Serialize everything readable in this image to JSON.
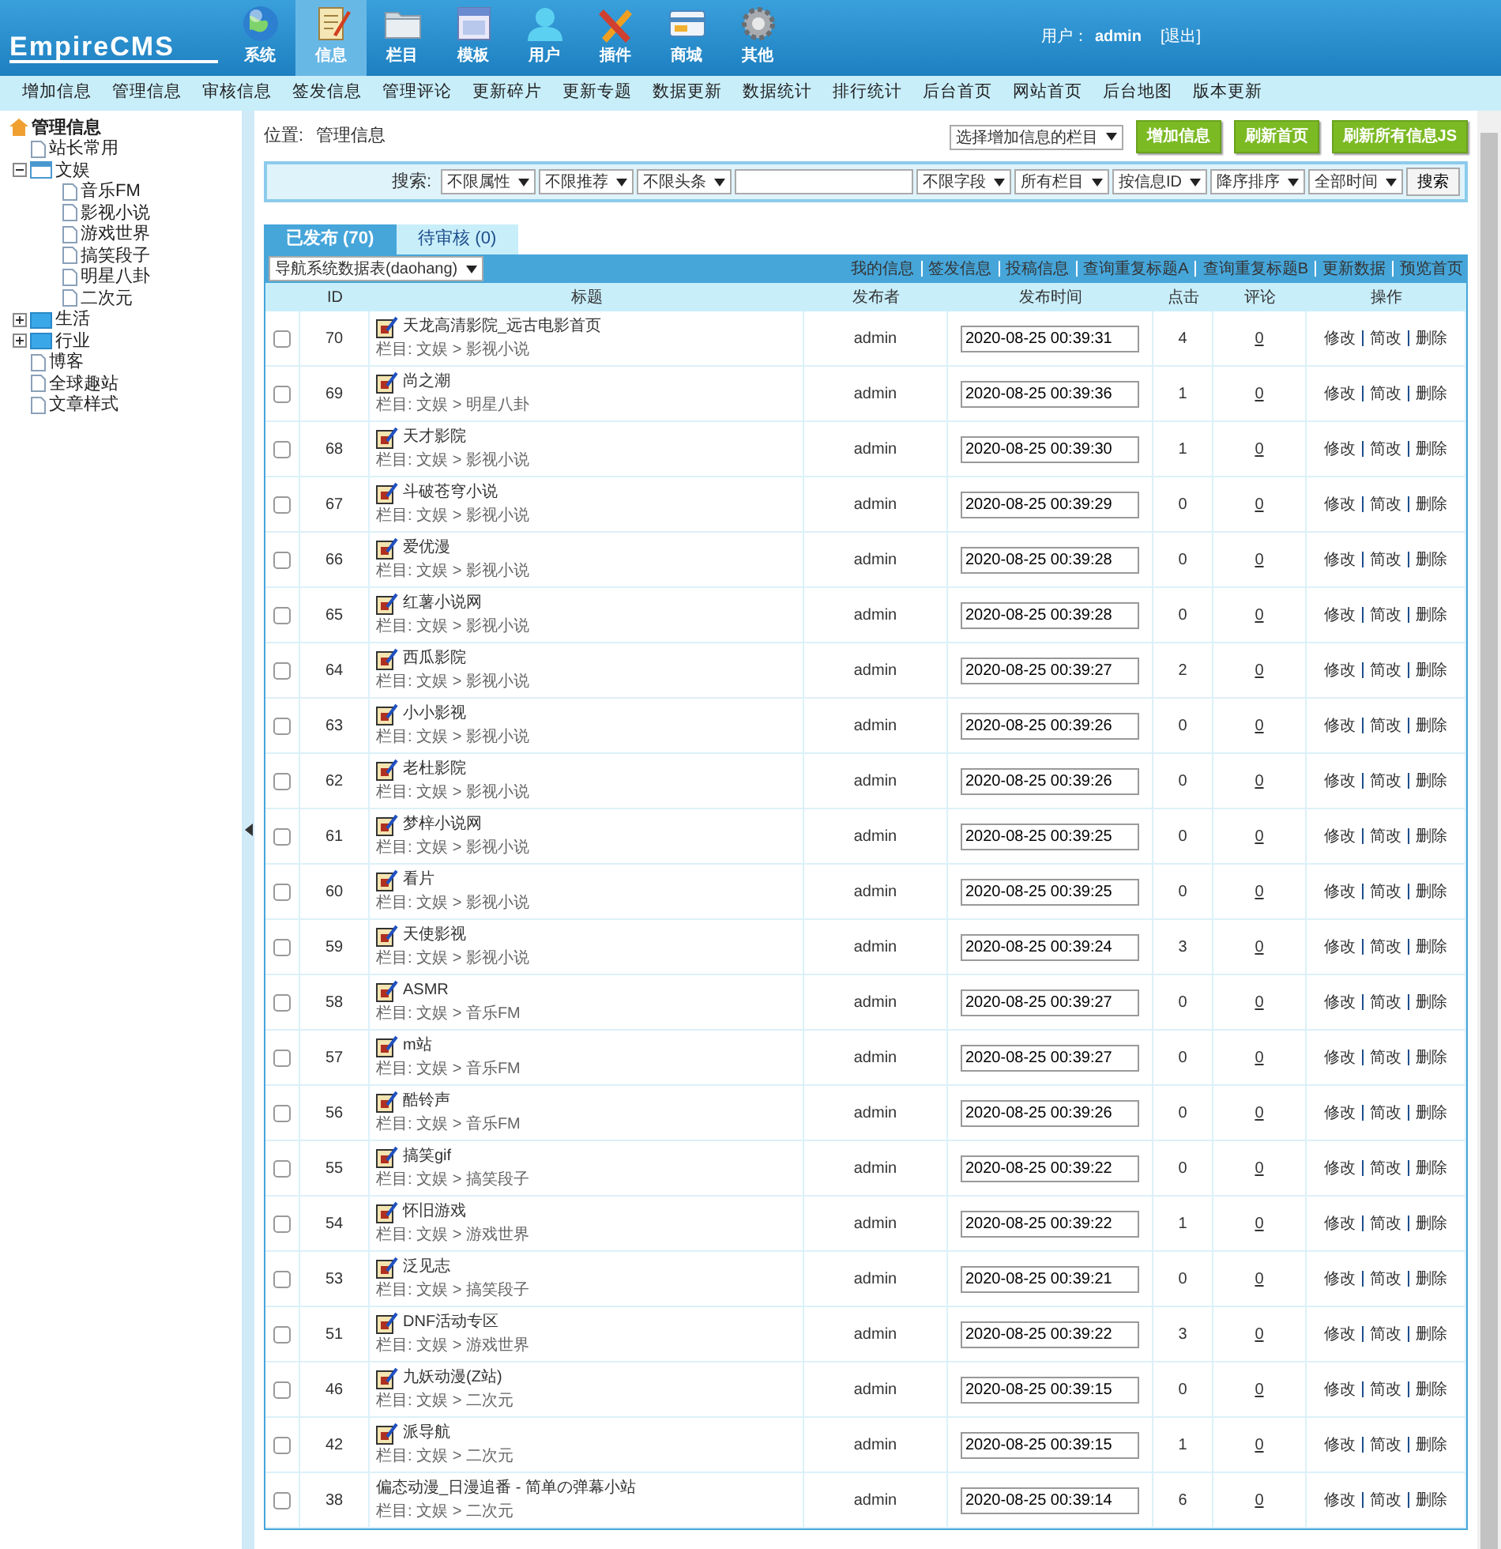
{
  "header": {
    "logo": "EmpireCMS",
    "nav": [
      {
        "label": "系统",
        "selected": false
      },
      {
        "label": "信息",
        "selected": true
      },
      {
        "label": "栏目",
        "selected": false
      },
      {
        "label": "模板",
        "selected": false
      },
      {
        "label": "用户",
        "selected": false
      },
      {
        "label": "插件",
        "selected": false
      },
      {
        "label": "商城",
        "selected": false
      },
      {
        "label": "其他",
        "selected": false
      }
    ],
    "user_label": "用户：",
    "user_name": "admin",
    "logout": "[退出]"
  },
  "submenu": [
    "增加信息",
    "管理信息",
    "审核信息",
    "签发信息",
    "管理评论",
    "更新碎片",
    "更新专题",
    "数据更新",
    "数据统计",
    "排行统计",
    "后台首页",
    "网站首页",
    "后台地图",
    "版本更新"
  ],
  "sidebar": {
    "root": "管理信息",
    "items": [
      {
        "label": "站长常用",
        "kind": "page"
      },
      {
        "label": "文娱",
        "kind": "folder",
        "expanded": true,
        "children": [
          {
            "label": "音乐FM",
            "kind": "page"
          },
          {
            "label": "影视小说",
            "kind": "page"
          },
          {
            "label": "游戏世界",
            "kind": "page"
          },
          {
            "label": "搞笑段子",
            "kind": "page"
          },
          {
            "label": "明星八卦",
            "kind": "page"
          },
          {
            "label": "二次元",
            "kind": "page"
          }
        ]
      },
      {
        "label": "生活",
        "kind": "folder",
        "expanded": false
      },
      {
        "label": "行业",
        "kind": "folder",
        "expanded": false
      },
      {
        "label": "博客",
        "kind": "page"
      },
      {
        "label": "全球趣站",
        "kind": "page"
      },
      {
        "label": "文章样式",
        "kind": "page"
      }
    ]
  },
  "location": {
    "label": "位置:",
    "link": "管理信息"
  },
  "toolbar": {
    "category_select": "选择增加信息的栏目",
    "buttons": [
      "增加信息",
      "刷新首页",
      "刷新所有信息JS"
    ]
  },
  "search": {
    "label": "搜索:",
    "selects_before": [
      "不限属性",
      "不限推荐",
      "不限头条"
    ],
    "selects_after": [
      "不限字段",
      "所有栏目",
      "按信息ID",
      "降序排序",
      "全部时间"
    ],
    "button": "搜索"
  },
  "tabs": [
    {
      "label": "已发布 (70)",
      "selected": true
    },
    {
      "label": "待审核 (0)",
      "selected": false
    }
  ],
  "table": {
    "table_select": "导航系统数据表(daohang)",
    "links": [
      "我的信息",
      "签发信息",
      "投稿信息",
      "查询重复标题A",
      "查询重复标题B",
      "更新数据",
      "预览首页"
    ],
    "columns": [
      "ID",
      "标题",
      "发布者",
      "发布时间",
      "点击",
      "评论",
      "操作"
    ],
    "rows": [
      {
        "id": "70",
        "title": "天龙高清影院_远古电影首页",
        "path": "栏目: 文娱 > 影视小说",
        "icon": true,
        "publisher": "admin",
        "time": "2020-08-25 00:39:31",
        "clicks": "4",
        "comments": "0",
        "actions": [
          "修改",
          "简改",
          "删除"
        ],
        "checked": false
      },
      {
        "id": "69",
        "title": "尚之潮",
        "path": "栏目: 文娱 > 明星八卦",
        "icon": true,
        "publisher": "admin",
        "time": "2020-08-25 00:39:36",
        "clicks": "1",
        "comments": "0",
        "actions": [
          "修改",
          "简改",
          "删除"
        ],
        "checked": false
      },
      {
        "id": "68",
        "title": "天才影院",
        "path": "栏目: 文娱 > 影视小说",
        "icon": true,
        "publisher": "admin",
        "time": "2020-08-25 00:39:30",
        "clicks": "1",
        "comments": "0",
        "actions": [
          "修改",
          "简改",
          "删除"
        ],
        "checked": false
      },
      {
        "id": "67",
        "title": "斗破苍穹小说",
        "path": "栏目: 文娱 > 影视小说",
        "icon": true,
        "publisher": "admin",
        "time": "2020-08-25 00:39:29",
        "clicks": "0",
        "comments": "0",
        "actions": [
          "修改",
          "简改",
          "删除"
        ],
        "checked": false
      },
      {
        "id": "66",
        "title": "爱优漫",
        "path": "栏目: 文娱 > 影视小说",
        "icon": true,
        "publisher": "admin",
        "time": "2020-08-25 00:39:28",
        "clicks": "0",
        "comments": "0",
        "actions": [
          "修改",
          "简改",
          "删除"
        ],
        "checked": false
      },
      {
        "id": "65",
        "title": "红薯小说网",
        "path": "栏目: 文娱 > 影视小说",
        "icon": true,
        "publisher": "admin",
        "time": "2020-08-25 00:39:28",
        "clicks": "0",
        "comments": "0",
        "actions": [
          "修改",
          "简改",
          "删除"
        ],
        "checked": false
      },
      {
        "id": "64",
        "title": "西瓜影院",
        "path": "栏目: 文娱 > 影视小说",
        "icon": true,
        "publisher": "admin",
        "time": "2020-08-25 00:39:27",
        "clicks": "2",
        "comments": "0",
        "actions": [
          "修改",
          "简改",
          "删除"
        ],
        "checked": false
      },
      {
        "id": "63",
        "title": "小小影视",
        "path": "栏目: 文娱 > 影视小说",
        "icon": true,
        "publisher": "admin",
        "time": "2020-08-25 00:39:26",
        "clicks": "0",
        "comments": "0",
        "actions": [
          "修改",
          "简改",
          "删除"
        ],
        "checked": false
      },
      {
        "id": "62",
        "title": "老杜影院",
        "path": "栏目: 文娱 > 影视小说",
        "icon": true,
        "publisher": "admin",
        "time": "2020-08-25 00:39:26",
        "clicks": "0",
        "comments": "0",
        "actions": [
          "修改",
          "简改",
          "删除"
        ],
        "checked": false
      },
      {
        "id": "61",
        "title": "梦梓小说网",
        "path": "栏目: 文娱 > 影视小说",
        "icon": true,
        "publisher": "admin",
        "time": "2020-08-25 00:39:25",
        "clicks": "0",
        "comments": "0",
        "actions": [
          "修改",
          "简改",
          "删除"
        ],
        "checked": false
      },
      {
        "id": "60",
        "title": "看片",
        "path": "栏目: 文娱 > 影视小说",
        "icon": true,
        "publisher": "admin",
        "time": "2020-08-25 00:39:25",
        "clicks": "0",
        "comments": "0",
        "actions": [
          "修改",
          "简改",
          "删除"
        ],
        "checked": false
      },
      {
        "id": "59",
        "title": "天使影视",
        "path": "栏目: 文娱 > 影视小说",
        "icon": true,
        "publisher": "admin",
        "time": "2020-08-25 00:39:24",
        "clicks": "3",
        "comments": "0",
        "actions": [
          "修改",
          "简改",
          "删除"
        ],
        "checked": false
      },
      {
        "id": "58",
        "title": "ASMR",
        "path": "栏目: 文娱 > 音乐FM",
        "icon": true,
        "publisher": "admin",
        "time": "2020-08-25 00:39:27",
        "clicks": "0",
        "comments": "0",
        "actions": [
          "修改",
          "简改",
          "删除"
        ],
        "checked": false
      },
      {
        "id": "57",
        "title": "m站",
        "path": "栏目: 文娱 > 音乐FM",
        "icon": true,
        "publisher": "admin",
        "time": "2020-08-25 00:39:27",
        "clicks": "0",
        "comments": "0",
        "actions": [
          "修改",
          "简改",
          "删除"
        ],
        "checked": false
      },
      {
        "id": "56",
        "title": "酷铃声",
        "path": "栏目: 文娱 > 音乐FM",
        "icon": true,
        "publisher": "admin",
        "time": "2020-08-25 00:39:26",
        "clicks": "0",
        "comments": "0",
        "actions": [
          "修改",
          "简改",
          "删除"
        ],
        "checked": false
      },
      {
        "id": "55",
        "title": "搞笑gif",
        "path": "栏目: 文娱 > 搞笑段子",
        "icon": true,
        "publisher": "admin",
        "time": "2020-08-25 00:39:22",
        "clicks": "0",
        "comments": "0",
        "actions": [
          "修改",
          "简改",
          "删除"
        ],
        "checked": false
      },
      {
        "id": "54",
        "title": "怀旧游戏",
        "path": "栏目: 文娱 > 游戏世界",
        "icon": true,
        "publisher": "admin",
        "time": "2020-08-25 00:39:22",
        "clicks": "1",
        "comments": "0",
        "actions": [
          "修改",
          "简改",
          "删除"
        ],
        "checked": false
      },
      {
        "id": "53",
        "title": "泛见志",
        "path": "栏目: 文娱 > 搞笑段子",
        "icon": true,
        "publisher": "admin",
        "time": "2020-08-25 00:39:21",
        "clicks": "0",
        "comments": "0",
        "actions": [
          "修改",
          "简改",
          "删除"
        ],
        "checked": false
      },
      {
        "id": "51",
        "title": "DNF活动专区",
        "path": "栏目: 文娱 > 游戏世界",
        "icon": true,
        "publisher": "admin",
        "time": "2020-08-25 00:39:22",
        "clicks": "3",
        "comments": "0",
        "actions": [
          "修改",
          "简改",
          "删除"
        ],
        "checked": false
      },
      {
        "id": "46",
        "title": "九妖动漫(Z站)",
        "path": "栏目: 文娱 > 二次元",
        "icon": true,
        "publisher": "admin",
        "time": "2020-08-25 00:39:15",
        "clicks": "0",
        "comments": "0",
        "actions": [
          "修改",
          "简改",
          "删除"
        ],
        "checked": false
      },
      {
        "id": "42",
        "title": "派导航",
        "path": "栏目: 文娱 > 二次元",
        "icon": true,
        "publisher": "admin",
        "time": "2020-08-25 00:39:15",
        "clicks": "1",
        "comments": "0",
        "actions": [
          "修改",
          "简改",
          "删除"
        ],
        "checked": false
      },
      {
        "id": "38",
        "title": "偏态动漫_日漫追番 - 简单の弹幕小站",
        "path": "栏目: 文娱 > 二次元",
        "icon": false,
        "publisher": "admin",
        "time": "2020-08-25 00:39:14",
        "clicks": "6",
        "comments": "0",
        "actions": [
          "修改",
          "简改",
          "删除"
        ],
        "checked": false
      }
    ]
  }
}
